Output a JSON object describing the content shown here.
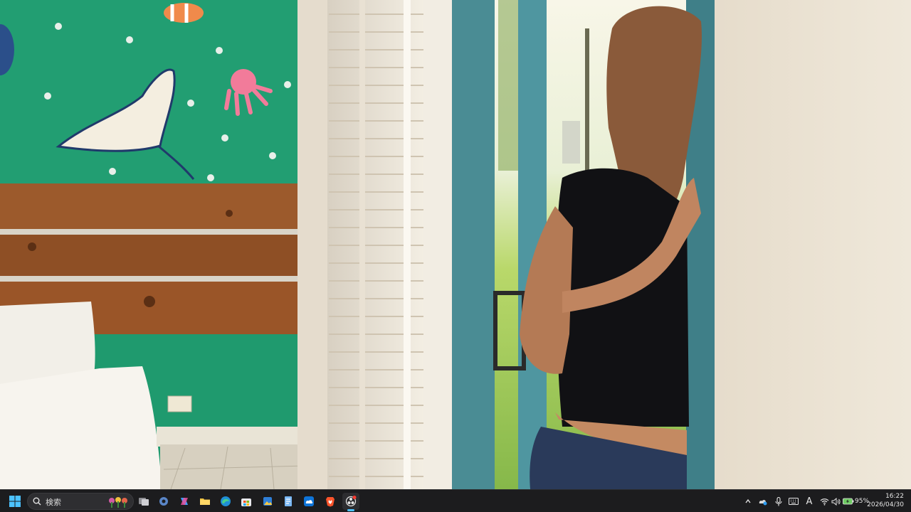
{
  "wallpaper": {
    "scene": "photo"
  },
  "taskbar": {
    "search_placeholder": "検索",
    "pinned_apps": [
      {
        "icon": "task-view-icon"
      },
      {
        "icon": "settings-icon"
      },
      {
        "icon": "copilot-icon"
      },
      {
        "icon": "file-explorer-icon"
      },
      {
        "icon": "edge-browser-icon"
      },
      {
        "icon": "microsoft-store-icon"
      },
      {
        "icon": "photos-icon"
      },
      {
        "icon": "notepad-icon"
      },
      {
        "icon": "onedrive-icon"
      },
      {
        "icon": "brave-browser-icon"
      },
      {
        "icon": "obs-studio-icon"
      }
    ],
    "tray": {
      "battery_percent": "95%",
      "ime_indicator": "A",
      "time": "16:22",
      "date": "2026/04/30"
    }
  },
  "colors": {
    "taskbar_bg": "#1c1c1e",
    "accent": "#4cc2ff",
    "wall_green": "#1f9a6e",
    "door_frame": "#4a8c94"
  }
}
